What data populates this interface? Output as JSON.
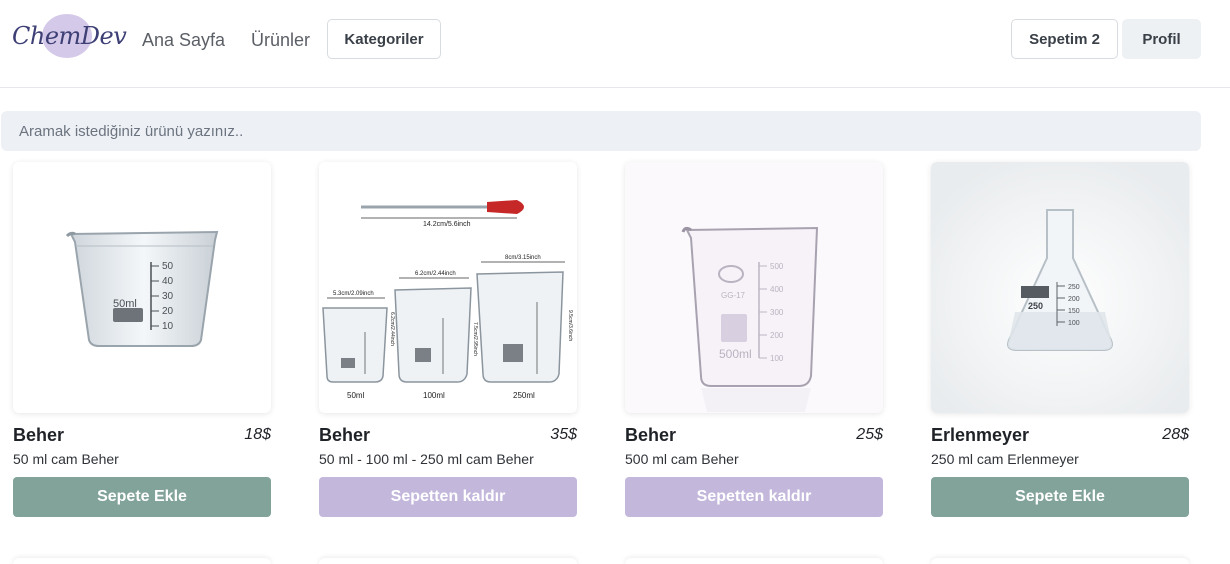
{
  "header": {
    "logo_text": "ChemDev",
    "nav": {
      "home": "Ana Sayfa",
      "products": "Ürünler",
      "categories": "Kategoriler"
    },
    "cart_label": "Sepetim 2",
    "profile_label": "Profil"
  },
  "search": {
    "placeholder": "Aramak istediğiniz ürünü yazınız.."
  },
  "products": [
    {
      "title": "Beher",
      "price": "18$",
      "description": "50 ml cam Beher",
      "button": "Sepete Ekle"
    },
    {
      "title": "Beher",
      "price": "35$",
      "description": "50 ml - 100 ml - 250 ml cam Beher",
      "button": "Sepetten kaldır"
    },
    {
      "title": "Beher",
      "price": "25$",
      "description": "500 ml cam Beher",
      "button": "Sepetten kaldır"
    },
    {
      "title": "Erlenmeyer",
      "price": "28$",
      "description": "250 ml cam Erlenmeyer",
      "button": "Sepete Ekle"
    }
  ],
  "images": {
    "img1": {
      "label": "50ml",
      "ticks": [
        "50",
        "40",
        "30",
        "20",
        "10"
      ]
    },
    "img2": {
      "pipette_dim": "14.2cm/5.6inch",
      "beakers": [
        {
          "label": "50ml",
          "top_dim": "5.3cm/2.09inch",
          "side_dim": "6.2cm/2.44inch"
        },
        {
          "label": "100ml",
          "top_dim": "6.2cm/2.44inch",
          "side_dim": "7.5cm/2.95inch"
        },
        {
          "label": "250ml",
          "top_dim": "8cm/3.15inch",
          "side_dim": "9.5cm/3.6inch"
        }
      ]
    },
    "img3": {
      "label": "500ml",
      "brand": "GG-17",
      "ticks": [
        "500",
        "400",
        "300",
        "200",
        "100"
      ]
    },
    "img4": {
      "label": "250",
      "ticks": [
        "250",
        "200",
        "150",
        "100"
      ]
    }
  },
  "colors": {
    "add_button": "#82a39a",
    "remove_button": "#c3b8dc",
    "logo_blob": "#cdbfe4",
    "logo_text": "#3d3f75"
  }
}
